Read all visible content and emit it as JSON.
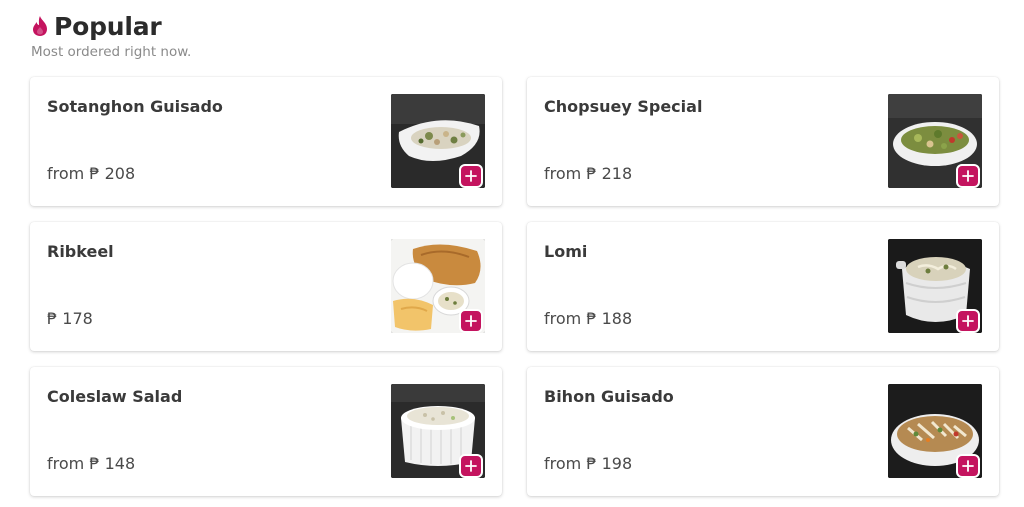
{
  "section": {
    "title": "Popular",
    "subtitle": "Most ordered right now.",
    "icon": "flame-icon",
    "accent_color": "#c4145f"
  },
  "items": [
    {
      "name": "Sotanghon Guisado",
      "price": "from ₱ 208",
      "image": "noodle-dish-white-bowl"
    },
    {
      "name": "Chopsuey Special",
      "price": "from ₱ 218",
      "image": "vegetable-dish-white-bowl"
    },
    {
      "name": "Ribkeel",
      "price": "₱ 178",
      "image": "fried-pork-rice-plate"
    },
    {
      "name": "Lomi",
      "price": "from ₱ 188",
      "image": "soup-white-tureen"
    },
    {
      "name": "Coleslaw Salad",
      "price": "from ₱ 148",
      "image": "coleslaw-white-ramekin"
    },
    {
      "name": "Bihon Guisado",
      "price": "from ₱ 198",
      "image": "rice-noodles-white-bowl"
    }
  ]
}
